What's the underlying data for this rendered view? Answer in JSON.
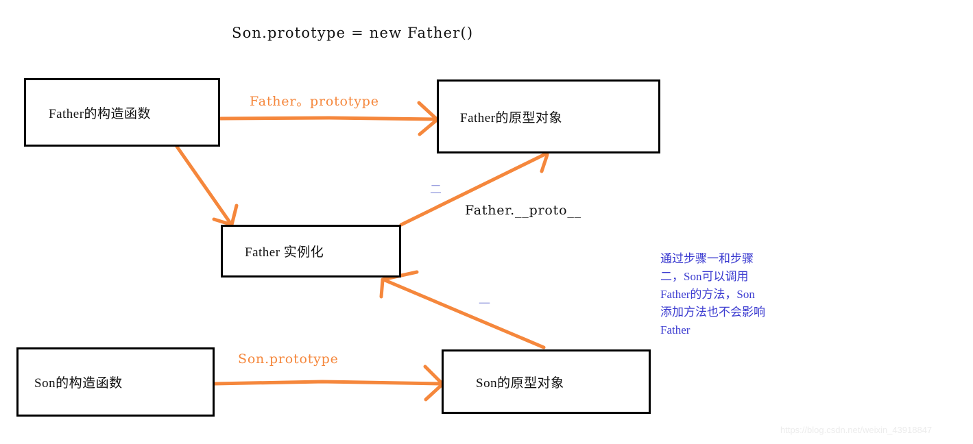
{
  "title": "Son.prototype = new Father()",
  "colors": {
    "arrow": "#F5873C",
    "box_border": "#000000",
    "note_text": "#3B3BD0",
    "step_marker": "#9aa0e0",
    "background": "#FFFFFF",
    "watermark": "#ECECEC"
  },
  "nodes": [
    {
      "id": "father-constructor",
      "label": "Father的构造函数"
    },
    {
      "id": "father-prototype",
      "label": "Father的原型对象"
    },
    {
      "id": "father-instance",
      "label": "Father 实例化"
    },
    {
      "id": "son-constructor",
      "label": "Son的构造函数"
    },
    {
      "id": "son-prototype",
      "label": "Son的原型对象"
    }
  ],
  "edges": [
    {
      "id": "father-prototype-edge",
      "label": "Father。prototype",
      "from": "father-constructor",
      "to": "father-prototype",
      "color": "orange"
    },
    {
      "id": "father-proto-edge",
      "label": "Father.__proto__",
      "from": "father-instance",
      "to": "father-prototype",
      "color": "black"
    },
    {
      "id": "son-prototype-edge",
      "label": "Son.prototype",
      "from": "son-constructor",
      "to": "son-prototype",
      "color": "orange"
    },
    {
      "id": "new-father-edge",
      "label": "",
      "from": "father-constructor",
      "to": "father-instance",
      "color": "orange"
    },
    {
      "id": "son-instance-edge",
      "label": "",
      "from": "son-prototype",
      "to": "father-instance",
      "color": "orange"
    }
  ],
  "step_markers": [
    {
      "id": "step-two",
      "label": "二"
    },
    {
      "id": "step-one",
      "label": "一"
    }
  ],
  "note": {
    "lines": [
      "通过步骤一和步骤",
      "二，Son可以调用",
      "Father的方法，Son",
      "添加方法也不会影响",
      "Father"
    ],
    "full_text": "通过步骤一和步骤二，Son可以调用Father的方法，Son添加方法也不会影响Father"
  },
  "watermark": "https://blog.csdn.net/weixin_43918847"
}
